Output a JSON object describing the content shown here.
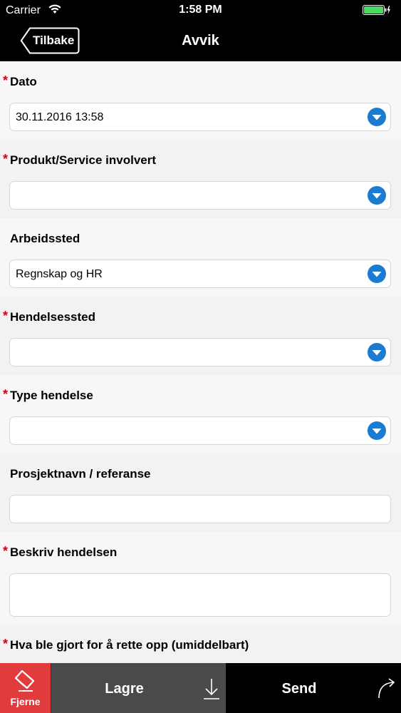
{
  "status_bar": {
    "carrier": "Carrier",
    "time": "1:58 PM"
  },
  "nav": {
    "back_label": "Tilbake",
    "title": "Avvik"
  },
  "fields": [
    {
      "label": "Dato",
      "required": true,
      "value": "30.11.2016 13:58",
      "type": "dropdown"
    },
    {
      "label": "Produkt/Service involvert",
      "required": true,
      "value": "",
      "type": "dropdown"
    },
    {
      "label": "Arbeidssted",
      "required": false,
      "value": "Regnskap og HR",
      "type": "dropdown"
    },
    {
      "label": "Hendelsessted",
      "required": true,
      "value": "",
      "type": "dropdown"
    },
    {
      "label": "Type hendelse",
      "required": true,
      "value": "",
      "type": "dropdown"
    },
    {
      "label": "Prosjektnavn / referanse",
      "required": false,
      "value": "",
      "type": "text"
    },
    {
      "label": "Beskriv hendelsen",
      "required": true,
      "value": "",
      "type": "textarea"
    },
    {
      "label": "Hva ble gjort for å rette opp (umiddelbart)",
      "required": true,
      "value": "",
      "type": "textarea"
    }
  ],
  "required_marker": "*",
  "bottom_bar": {
    "remove_label": "Fjerne",
    "save_label": "Lagre",
    "send_label": "Send"
  },
  "colors": {
    "accent_blue": "#1a7bd0",
    "required_red": "#d0021b",
    "remove_red": "#e23b3b",
    "save_gray": "#4a4a4a",
    "battery_green": "#4cd964"
  },
  "icons": {
    "wifi": "wifi-icon",
    "battery": "battery-icon",
    "back": "chevron-left-icon",
    "dropdown": "chevron-down-circle-icon",
    "remove": "eraser-icon",
    "save": "download-arrow-icon",
    "send": "curved-arrow-icon"
  }
}
